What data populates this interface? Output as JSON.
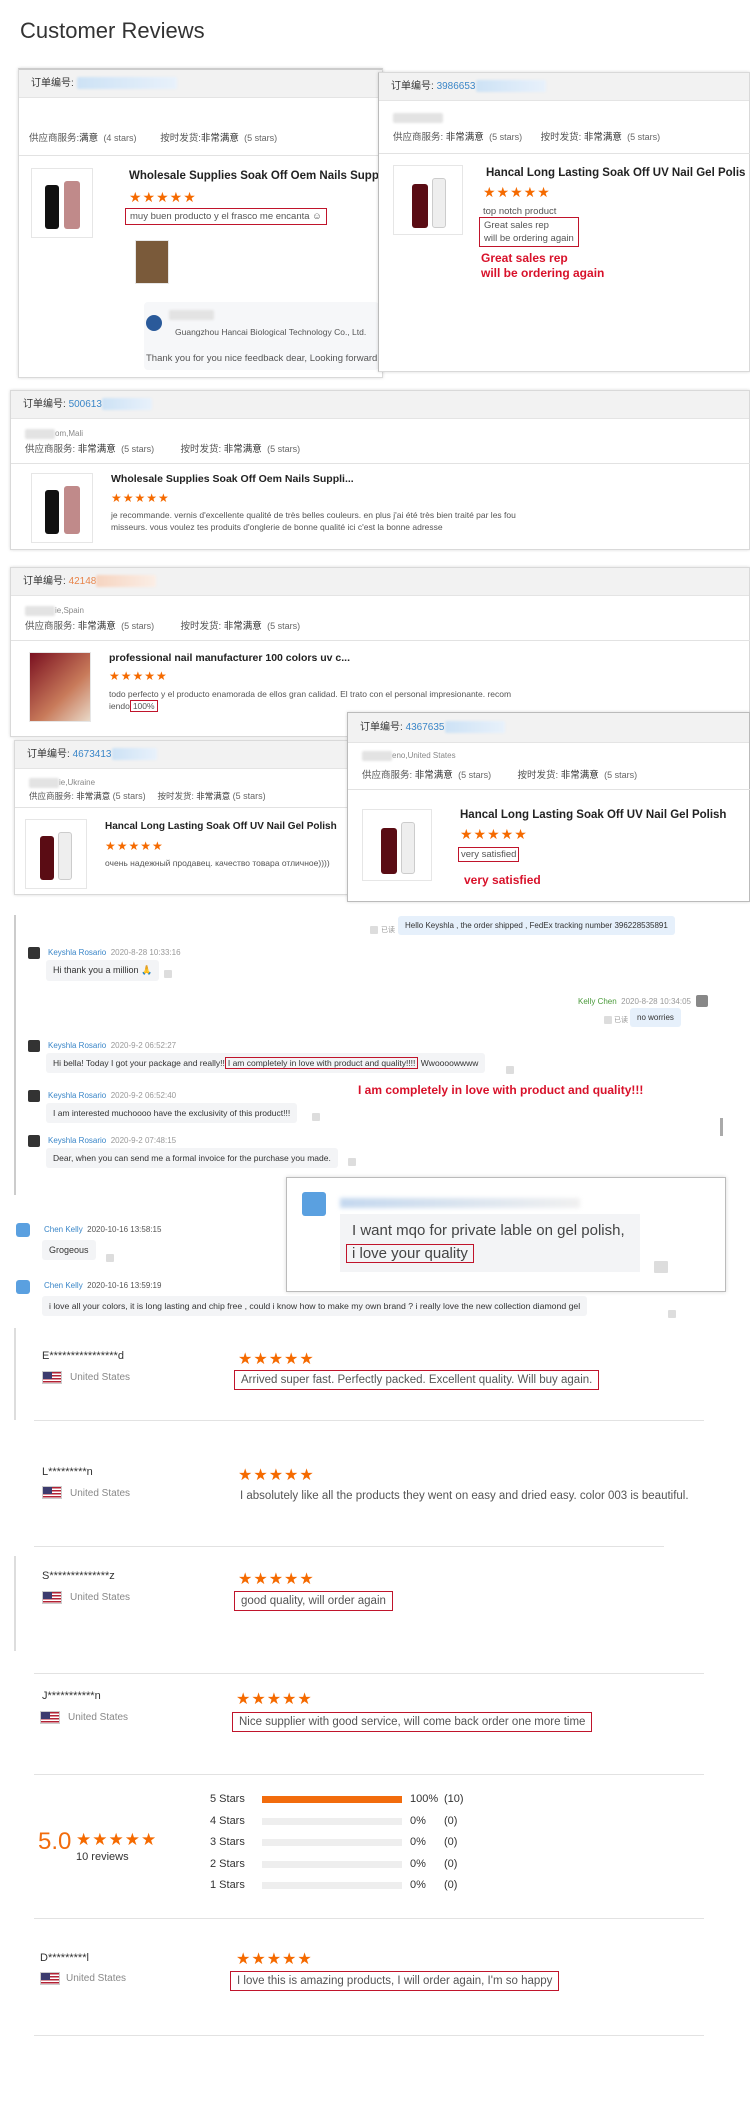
{
  "page_title": "Customer Reviews",
  "labels": {
    "order_no": "订单编号:",
    "supplier_service": "供应商服务:",
    "shipping": "按时发货:",
    "very_satisfied_cn": "非常满意",
    "satisfied_cn": "满意",
    "stars4": "(4 stars)",
    "stars5": "(5 stars)"
  },
  "card1": {
    "title": "Wholesale Supplies Soak Off Oem Nails Suppli...",
    "review": "muy buen producto y el frasco me encanta ☺",
    "reply_company": "Guangzhou Hancai Biological Technology Co., Ltd.",
    "reply_text": "Thank you for you nice feedback dear, Looking forward to your cooperation again."
  },
  "card2": {
    "order_num": "3986653",
    "title": "Hancal Long Lasting Soak Off UV Nail Gel Polish",
    "line1": "top notch product",
    "line2": "Great sales rep",
    "line3": "will be ordering again",
    "annot1": "Great sales rep",
    "annot2": "will be ordering again"
  },
  "card3": {
    "order_num": "500613",
    "buyer": "om,Mali",
    "title": "Wholesale Supplies Soak Off Oem Nails Suppli...",
    "review1": "je recommande. vernis d'excellente qualité de très belles couleurs. en plus j'ai été très bien traité par les fou",
    "review2": "misseurs. vous voulez tes produits d'onglerie de bonne qualité ici c'est la bonne adresse"
  },
  "card4": {
    "order_num": "42148",
    "buyer": "ie,Spain",
    "title": "professional nail manufacturer 100 colors uv c...",
    "review1": "todo perfecto y el producto enamorada de ellos gran calidad. El trato con el personal impresionante. recom",
    "review2_pre": "iendo",
    "review2_box": "100%"
  },
  "card5": {
    "order_num": "4673413",
    "buyer": "ie,Ukraine",
    "title": "Hancal Long Lasting Soak Off UV Nail Gel Polish",
    "review": "очень надежный продавец. качество  товара отличное))))"
  },
  "card6": {
    "order_num": "4367635",
    "buyer": "eno,United States",
    "title": "Hancal Long Lasting Soak Off UV Nail Gel Polish",
    "review": "very satisfied",
    "annot": "very satisfied"
  },
  "chat": {
    "read_label": "已读",
    "msg1": "Hello Keyshla , the order shipped , FedEx tracking number 396228535891",
    "k1_name": "Keyshla Rosario",
    "k1_time": "2020-8-28 10:33:16",
    "k1_msg": "Hi thank you a million 🙏",
    "kc_name": "Kelly Chen",
    "kc_time": "2020-8-28 10:34:05",
    "kc_msg": "no worries",
    "k2_time": "2020-9-2 06:52:27",
    "k2_pre": "Hi bella! Today I got your package and really!!",
    "k2_box": "I am completely in love with product and quality!!!!",
    "k2_post": " Wwoooowwww",
    "k2_annot": "I am completely in love with product and quality!!!",
    "k3_time": "2020-9-2 06:52:40",
    "k3_msg": "I am interested muchoooo have the exclusivity of this product!!!",
    "k4_time": "2020-9-2 07:48:15",
    "k4_msg": "Dear, when you can send me a formal invoice for the purchase you made.",
    "c1_name": "Chen Kelly",
    "c1_time": "2020-10-16 13:58:15",
    "c1_msg": "Grogeous",
    "c2_time": "2020-10-16 13:59:19",
    "c2_msg": "i love all your colors, it is long lasting and chip free , could i know how to make my own brand ? i really love the new collection diamond gel",
    "big_line1": "I want mqo for private lable on gel polish,",
    "big_line2": "i love your quality"
  },
  "reviews": [
    {
      "name": "E****************d",
      "country": "United States",
      "text": "Arrived super fast. Perfectly packed. Excellent quality. Will buy again.",
      "boxed": true
    },
    {
      "name": "L*********n",
      "country": "United States",
      "text": "I absolutely like all the products they went on easy and dried easy. color 003 is beautiful.",
      "boxed": false
    },
    {
      "name": "S**************z",
      "country": "United States",
      "text": "good quality, will order again",
      "boxed": true
    },
    {
      "name": "J***********n",
      "country": "United States",
      "text": "Nice supplier with good service, will come back order one more time",
      "boxed": true
    },
    {
      "name": "D*********l",
      "country": "United States",
      "text": "I love this is amazing products, I will order again, I'm so happy",
      "boxed": true
    }
  ],
  "summary": {
    "score": "5.0",
    "count": "10 reviews",
    "rows": [
      {
        "label": "5 Stars",
        "pct": "100%",
        "count": "(10)",
        "fill": 1.0
      },
      {
        "label": "4 Stars",
        "pct": "0%",
        "count": "(0)",
        "fill": 0
      },
      {
        "label": "3 Stars",
        "pct": "0%",
        "count": "(0)",
        "fill": 0
      },
      {
        "label": "2 Stars",
        "pct": "0%",
        "count": "(0)",
        "fill": 0
      },
      {
        "label": "1 Stars",
        "pct": "0%",
        "count": "(0)",
        "fill": 0
      }
    ]
  },
  "stars_glyph": "★★★★★",
  "colors": {
    "accent": "#f56a00",
    "highlight": "#c0142b",
    "link": "#3a86c8"
  }
}
